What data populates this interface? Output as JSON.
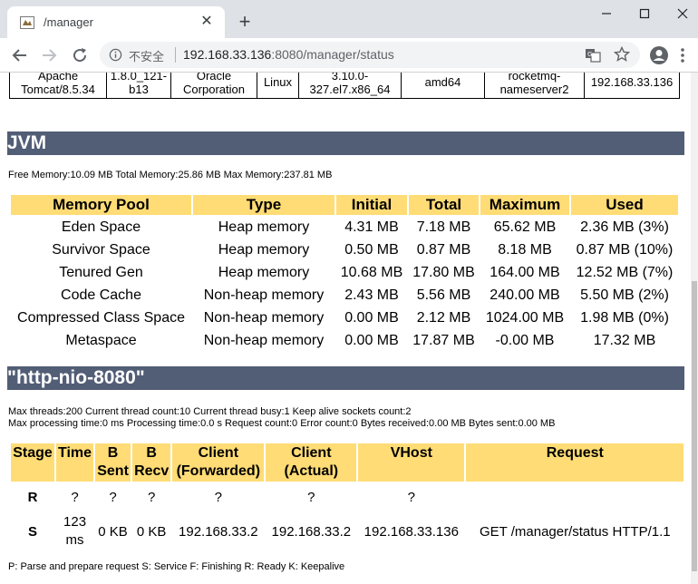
{
  "browser": {
    "tab_title": "/manager",
    "security_label": "不安全",
    "url_host": "192.168.33.136",
    "url_rest": ":8080/manager/status"
  },
  "server_info": {
    "cells": [
      "Apache Tomcat/8.5.34",
      "1.8.0_121-b13",
      "Oracle Corporation",
      "Linux",
      "3.10.0-327.el7.x86_64",
      "amd64",
      "rocketmq-nameserver2",
      "192.168.33.136"
    ]
  },
  "jvm": {
    "heading": "JVM",
    "memory_summary": "Free Memory:10.09 MB Total Memory:25.86 MB Max Memory:237.81 MB",
    "columns": [
      "Memory Pool",
      "Type",
      "Initial",
      "Total",
      "Maximum",
      "Used"
    ],
    "rows": [
      [
        "Eden Space",
        "Heap memory",
        "4.31 MB",
        "7.18 MB",
        "65.62 MB",
        "2.36 MB (3%)"
      ],
      [
        "Survivor Space",
        "Heap memory",
        "0.50 MB",
        "0.87 MB",
        "8.18 MB",
        "0.87 MB (10%)"
      ],
      [
        "Tenured Gen",
        "Heap memory",
        "10.68 MB",
        "17.80 MB",
        "164.00 MB",
        "12.52 MB (7%)"
      ],
      [
        "Code Cache",
        "Non-heap memory",
        "2.43 MB",
        "5.56 MB",
        "240.00 MB",
        "5.50 MB (2%)"
      ],
      [
        "Compressed Class Space",
        "Non-heap memory",
        "0.00 MB",
        "2.12 MB",
        "1024.00 MB",
        "1.98 MB (0%)"
      ],
      [
        "Metaspace",
        "Non-heap memory",
        "0.00 MB",
        "17.87 MB",
        "-0.00 MB",
        "17.32 MB"
      ]
    ]
  },
  "connector": {
    "heading": "\"http-nio-8080\"",
    "thread_info": "Max threads:200 Current thread count:10 Current thread busy:1 Keep alive sockets count:2",
    "processing_info": "Max processing time:0 ms Processing time:0.0 s Request count:0 Error count:0 Bytes received:0.00 MB Bytes sent:0.00 MB",
    "columns": [
      {
        "line1": "Stage",
        "line2": ""
      },
      {
        "line1": "Time",
        "line2": ""
      },
      {
        "line1": "B",
        "line2": "Sent"
      },
      {
        "line1": "B",
        "line2": "Recv"
      },
      {
        "line1": "Client",
        "line2": "(Forwarded)"
      },
      {
        "line1": "Client",
        "line2": "(Actual)"
      },
      {
        "line1": "VHost",
        "line2": ""
      },
      {
        "line1": "Request",
        "line2": ""
      }
    ],
    "rows": [
      {
        "stage": "R",
        "time1": "?",
        "time2": "",
        "sent": "?",
        "recv": "?",
        "client_fwd": "?",
        "client_actual": "?",
        "vhost": "?",
        "request": ""
      },
      {
        "stage": "S",
        "time1": "123",
        "time2": "ms",
        "sent": "0 KB",
        "recv": "0 KB",
        "client_fwd": "192.168.33.2",
        "client_actual": "192.168.33.2",
        "vhost": "192.168.33.136",
        "request": "GET /manager/status HTTP/1.1"
      }
    ],
    "legend": "P: Parse and prepare request S: Service F: Finishing R: Ready K: Keepalive"
  }
}
